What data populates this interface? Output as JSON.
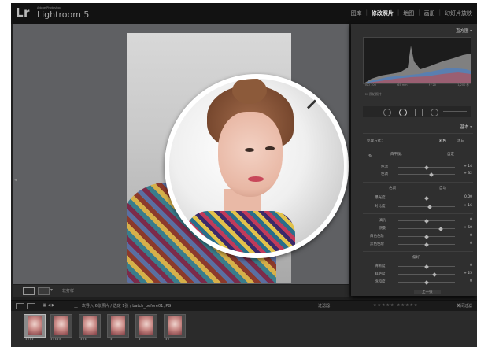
{
  "app": {
    "logo_mark": "Lr",
    "logo_small": "Adobe Photoshop",
    "name": "Lightroom 5"
  },
  "modules": [
    "图库",
    "修改照片",
    "地图",
    "画册",
    "幻灯片放映"
  ],
  "active_module": "修改照片",
  "panel": {
    "histogram_title": "直方图",
    "histogram_readout": [
      "ISO 100",
      "65 mm",
      "f / 20",
      "1/200 秒"
    ],
    "original_photo_label": "原始照片",
    "basic_title": "基本",
    "treatment_label": "处理方式：",
    "treatment_options": [
      "彩色",
      "黑白"
    ],
    "wb_label": "白平衡：",
    "wb_value": "自定",
    "temp_label": "色温",
    "temp_value": "+ 14",
    "tint_label": "色调",
    "tint_value": "+ 32",
    "tone_label": "色调",
    "auto_label": "自动",
    "exposure_label": "曝光度",
    "exposure_value": "0.00",
    "contrast_label": "对比度",
    "contrast_value": "+ 16",
    "highlights_label": "高光",
    "highlights_value": "0",
    "shadows_label": "阴影",
    "shadows_value": "+ 50",
    "whites_label": "白色色阶",
    "whites_value": "0",
    "blacks_label": "黑色色阶",
    "blacks_value": "0",
    "presence_label": "偏好",
    "clarity_label": "清晰度",
    "clarity_value": "0",
    "vibrance_label": "鲜艳度",
    "vibrance_value": "+ 25",
    "saturation_label": "饱和度",
    "saturation_value": "0",
    "prev_button": "上一张"
  },
  "toolbar": {
    "soft_proof_label": "软打样"
  },
  "filmbar": {
    "nav_text": "上一次导入  6张照片 / 选定 1张 / batch_before01.JPG",
    "filter_label": "过滤器：",
    "custom_filter": "关闭过滤"
  },
  "thumbnails": [
    {
      "selected": true,
      "stars": "★★★★"
    },
    {
      "selected": false,
      "stars": "★★★★★"
    },
    {
      "selected": false,
      "stars": "★★★"
    },
    {
      "selected": false,
      "stars": "★"
    },
    {
      "selected": false,
      "stars": "★"
    },
    {
      "selected": false,
      "stars": "★★"
    }
  ],
  "colors": {
    "accent_panel": "#2f2f2f",
    "viewer_bg": "#5f6063",
    "frame_border": "#ffffff"
  }
}
